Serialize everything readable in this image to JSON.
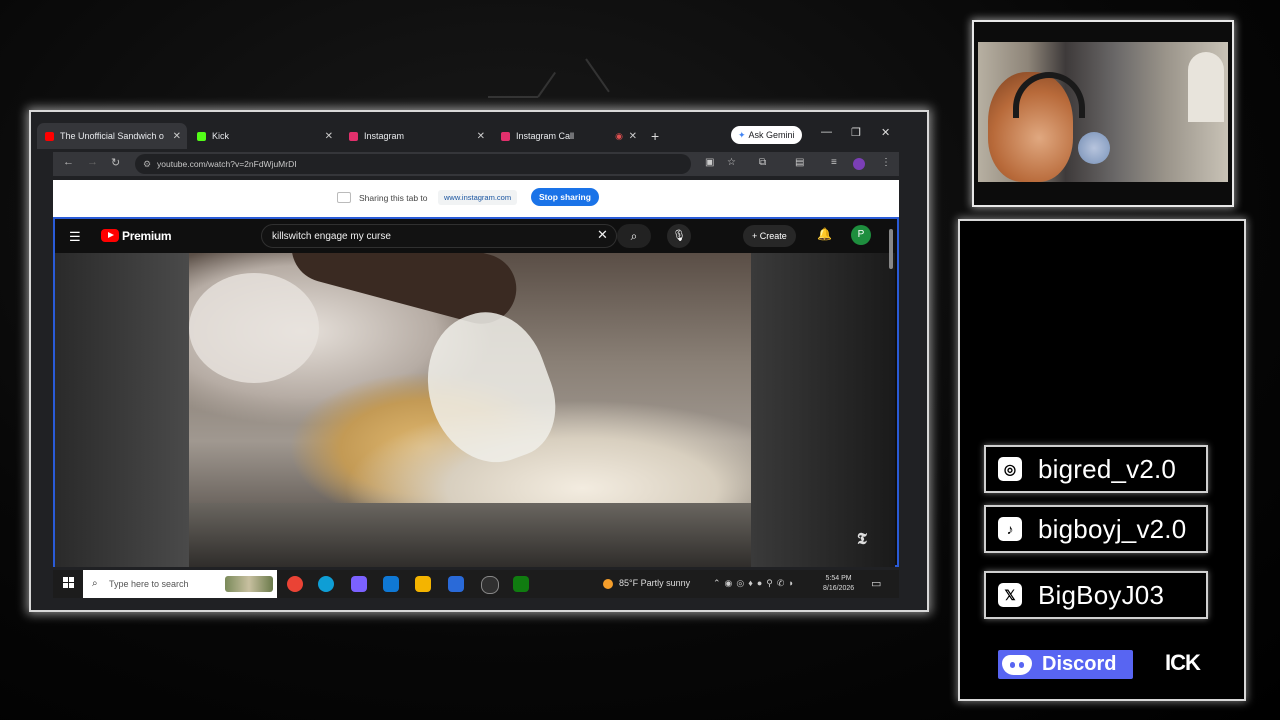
{
  "browser": {
    "tabs": [
      {
        "label": "The Unofficial Sandwich o",
        "favicon_color": "#ff0000",
        "active": true
      },
      {
        "label": "Kick",
        "favicon_color": "#53fc18",
        "active": false
      },
      {
        "label": "Instagram",
        "favicon_color": "#e1306c",
        "active": false
      },
      {
        "label": "Instagram Call",
        "favicon_color": "#e1306c",
        "active": false
      }
    ],
    "new_tab_symbol": "+",
    "gemini_label": "Ask Gemini",
    "url": "youtube.com/watch?v=2nFdWjuMrDI"
  },
  "share_bar": {
    "text": "Sharing this tab to",
    "target": "www.instagram.com",
    "stop_label": "Stop sharing"
  },
  "youtube": {
    "brand": "Premium",
    "search_query": "killswitch engage my curse",
    "create_label": "Create",
    "avatar_letter": "P",
    "watermark": "𝕿"
  },
  "taskbar": {
    "search_placeholder": "Type here to search",
    "weather": "85°F  Partly sunny",
    "time": "5:54 PM",
    "date": "8/16/2026",
    "apps": [
      {
        "name": "chrome",
        "color": "#ea4335"
      },
      {
        "name": "edge",
        "color": "#0f9ed5"
      },
      {
        "name": "copilot",
        "color": "#7b61ff"
      },
      {
        "name": "outlook",
        "color": "#0f78d4"
      },
      {
        "name": "file-explorer",
        "color": "#f4b400"
      },
      {
        "name": "store",
        "color": "#2a6ad8"
      },
      {
        "name": "obs",
        "color": "#303030"
      },
      {
        "name": "xbox",
        "color": "#107c10"
      }
    ]
  },
  "socials": {
    "instagram": "bigred_v2.0",
    "tiktok": "bigboyj_v2.0",
    "x": "BigBoyJ03",
    "discord": "Discord",
    "kick": "ICK"
  },
  "colors": {
    "accent_blue": "#1a73e8",
    "youtube_red": "#ff0000",
    "discord_blurple": "#5865f2"
  }
}
